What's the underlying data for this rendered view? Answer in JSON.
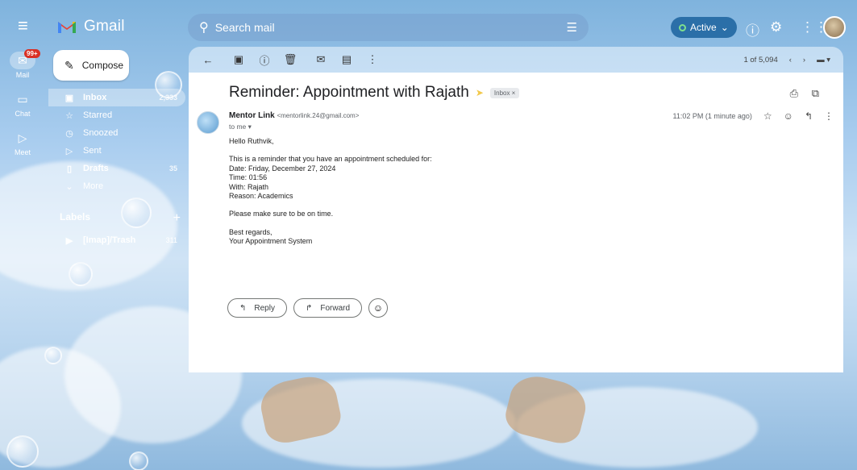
{
  "app": {
    "name": "Gmail"
  },
  "search": {
    "placeholder": "Search mail"
  },
  "status": {
    "label": "Active"
  },
  "rail": {
    "mail": {
      "label": "Mail",
      "badge": "99+"
    },
    "chat": {
      "label": "Chat"
    },
    "meet": {
      "label": "Meet"
    }
  },
  "compose": {
    "label": "Compose"
  },
  "nav": [
    {
      "label": "Inbox",
      "count": "2,333",
      "icon": "inbox-icon"
    },
    {
      "label": "Starred",
      "count": "",
      "icon": "star-icon"
    },
    {
      "label": "Snoozed",
      "count": "",
      "icon": "clock-icon"
    },
    {
      "label": "Sent",
      "count": "",
      "icon": "send-icon"
    },
    {
      "label": "Drafts",
      "count": "35",
      "icon": "draft-icon"
    },
    {
      "label": "More",
      "count": "",
      "icon": "chevron-down-icon"
    }
  ],
  "labels": {
    "heading": "Labels",
    "items": [
      {
        "label": "[Imap]/Trash",
        "count": "311"
      }
    ]
  },
  "toolbar": {
    "pager": "1 of 5,094"
  },
  "message": {
    "subject": "Reminder: Appointment with Rajath",
    "chip": "Inbox ×",
    "sender_name": "Mentor Link",
    "sender_email": "<mentorlink.24@gmail.com>",
    "to": "to me ▾",
    "time": "11:02 PM (1 minute ago)",
    "body": {
      "greeting": "Hello Ruthvik,",
      "line1": "This is a reminder that you have an appointment scheduled for:",
      "date": "Date: Friday, December 27, 2024",
      "time": "Time: 01:56",
      "with": "With: Rajath",
      "reason": "Reason: Academics",
      "line2": "Please make sure to be on time.",
      "closing": "Best regards,",
      "signature": "Your Appointment System"
    }
  },
  "actions": {
    "reply": "Reply",
    "forward": "Forward"
  }
}
